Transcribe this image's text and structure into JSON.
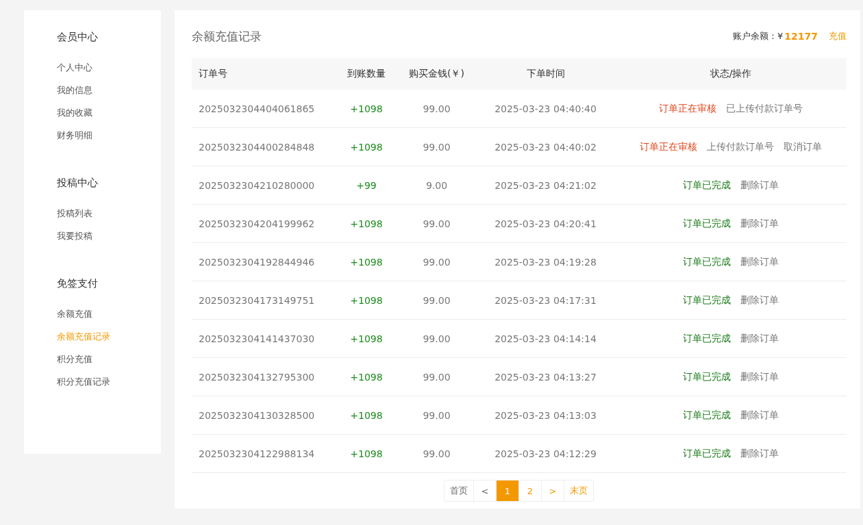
{
  "sidebar": {
    "sections": [
      {
        "title": "会员中心",
        "items": [
          {
            "label": "个人中心",
            "selected": false
          },
          {
            "label": "我的信息",
            "selected": false
          },
          {
            "label": "我的收藏",
            "selected": false
          },
          {
            "label": "财务明细",
            "selected": false
          }
        ]
      },
      {
        "title": "投稿中心",
        "items": [
          {
            "label": "投稿列表",
            "selected": false
          },
          {
            "label": "我要投稿",
            "selected": false
          }
        ]
      },
      {
        "title": "免签支付",
        "items": [
          {
            "label": "余额充值",
            "selected": false
          },
          {
            "label": "余额充值记录",
            "selected": true
          },
          {
            "label": "积分充值",
            "selected": false
          },
          {
            "label": "积分充值记录",
            "selected": false
          }
        ]
      }
    ]
  },
  "page_title": "余额充值记录",
  "balance": {
    "label": "账户余额：¥",
    "amount": "12177",
    "action": "充值"
  },
  "table": {
    "columns": [
      "订单号",
      "到账数量",
      "购买金钱(￥)",
      "下单时间",
      "状态/操作"
    ],
    "rows": [
      {
        "order": "2025032304404061865",
        "qty": "+1098",
        "money": "99.00",
        "time": "2025-03-23 04:40:40",
        "status": {
          "kind": "pending",
          "label": "订单正在审核"
        },
        "actions": [
          "已上传付款订单号"
        ]
      },
      {
        "order": "2025032304400284848",
        "qty": "+1098",
        "money": "99.00",
        "time": "2025-03-23 04:40:02",
        "status": {
          "kind": "pending",
          "label": "订单正在审核"
        },
        "actions": [
          "上传付款订单号",
          "取消订单"
        ]
      },
      {
        "order": "2025032304210280000",
        "qty": "+99",
        "money": "9.00",
        "time": "2025-03-23 04:21:02",
        "status": {
          "kind": "done",
          "label": "订单已完成"
        },
        "actions": [
          "删除订单"
        ]
      },
      {
        "order": "2025032304204199962",
        "qty": "+1098",
        "money": "99.00",
        "time": "2025-03-23 04:20:41",
        "status": {
          "kind": "done",
          "label": "订单已完成"
        },
        "actions": [
          "删除订单"
        ]
      },
      {
        "order": "2025032304192844946",
        "qty": "+1098",
        "money": "99.00",
        "time": "2025-03-23 04:19:28",
        "status": {
          "kind": "done",
          "label": "订单已完成"
        },
        "actions": [
          "删除订单"
        ]
      },
      {
        "order": "2025032304173149751",
        "qty": "+1098",
        "money": "99.00",
        "time": "2025-03-23 04:17:31",
        "status": {
          "kind": "done",
          "label": "订单已完成"
        },
        "actions": [
          "删除订单"
        ]
      },
      {
        "order": "2025032304141437030",
        "qty": "+1098",
        "money": "99.00",
        "time": "2025-03-23 04:14:14",
        "status": {
          "kind": "done",
          "label": "订单已完成"
        },
        "actions": [
          "删除订单"
        ]
      },
      {
        "order": "2025032304132795300",
        "qty": "+1098",
        "money": "99.00",
        "time": "2025-03-23 04:13:27",
        "status": {
          "kind": "done",
          "label": "订单已完成"
        },
        "actions": [
          "删除订单"
        ]
      },
      {
        "order": "2025032304130328500",
        "qty": "+1098",
        "money": "99.00",
        "time": "2025-03-23 04:13:03",
        "status": {
          "kind": "done",
          "label": "订单已完成"
        },
        "actions": [
          "删除订单"
        ]
      },
      {
        "order": "2025032304122988134",
        "qty": "+1098",
        "money": "99.00",
        "time": "2025-03-23 04:12:29",
        "status": {
          "kind": "done",
          "label": "订单已完成"
        },
        "actions": [
          "删除订单"
        ]
      }
    ]
  },
  "pagination": [
    {
      "label": "首页",
      "selected": false,
      "disabled": true
    },
    {
      "label": "<",
      "selected": false,
      "disabled": true
    },
    {
      "label": "1",
      "selected": true,
      "disabled": false
    },
    {
      "label": "2",
      "selected": false,
      "disabled": false
    },
    {
      "label": ">",
      "selected": false,
      "disabled": false
    },
    {
      "label": "末页",
      "selected": false,
      "disabled": false
    }
  ]
}
